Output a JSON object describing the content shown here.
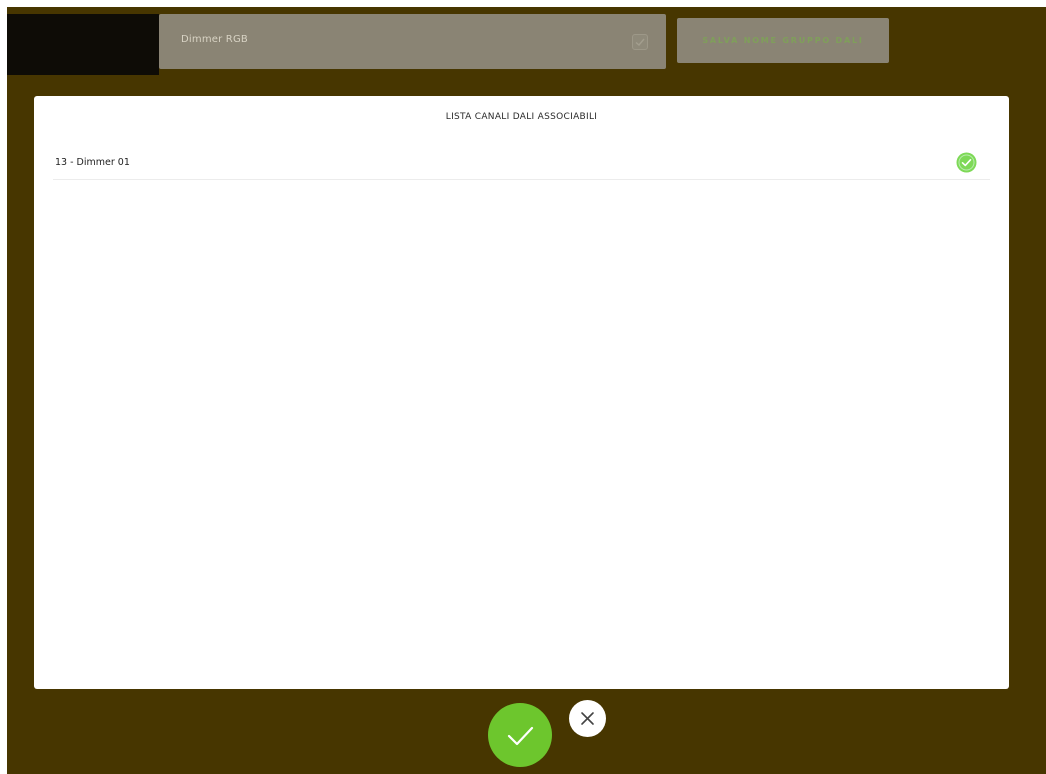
{
  "header": {
    "group_name_value": "Dimmer RGB",
    "save_button_label": "SALVA NOME GRUPPO DALI"
  },
  "dialog": {
    "title": "LISTA CANALI DALI ASSOCIABILI",
    "channels": [
      {
        "label": "13 - Dimmer 01",
        "selected": true
      }
    ]
  },
  "actions": {
    "confirm_icon": "check-icon",
    "cancel_icon": "close-icon"
  },
  "colors": {
    "overlay_background": "#473600",
    "accent_green": "#6dc62d",
    "row_check_green": "#7ed957"
  }
}
